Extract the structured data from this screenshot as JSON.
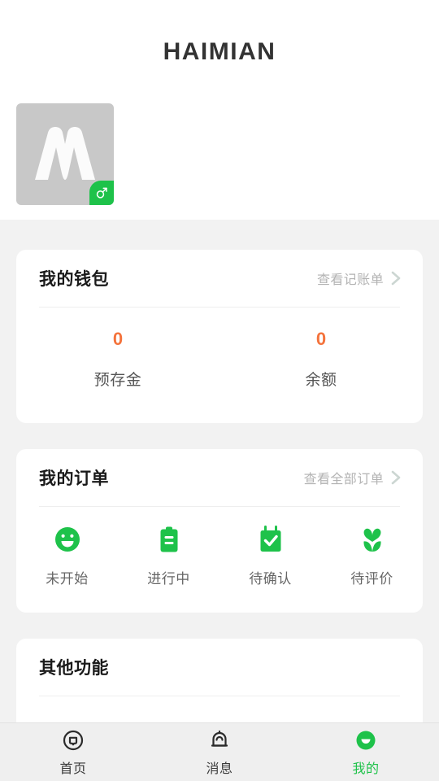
{
  "app": {
    "title": "HAIMIAN",
    "accent_green": "#1ec24a",
    "accent_orange": "#f4733c",
    "page_background": "#f2f2f2",
    "card_background": "#ffffff"
  },
  "profile": {
    "avatar_icon": "letter-m-logo",
    "avatar_background": "#c8c8c8",
    "gender_badge_icon": "male-symbol-icon",
    "gender_badge_color": "#1ec24a"
  },
  "wallet": {
    "title": "我的钱包",
    "action_label": "查看记账单",
    "action_icon": "chevron-right-icon",
    "stats": [
      {
        "value": "0",
        "label": "预存金"
      },
      {
        "value": "0",
        "label": "余额"
      }
    ]
  },
  "orders": {
    "title": "我的订单",
    "action_label": "查看全部订单",
    "action_icon": "chevron-right-icon",
    "items": [
      {
        "label": "未开始",
        "icon": "smiley-face-icon"
      },
      {
        "label": "进行中",
        "icon": "clipboard-icon"
      },
      {
        "label": "待确认",
        "icon": "calendar-check-icon"
      },
      {
        "label": "待评价",
        "icon": "heart-flower-icon"
      }
    ]
  },
  "other_functions": {
    "title": "其他功能"
  },
  "tabbar": {
    "tabs": [
      {
        "label": "首页",
        "icon": "home-circle-icon",
        "active": false
      },
      {
        "label": "消息",
        "icon": "bell-icon",
        "active": false
      },
      {
        "label": "我的",
        "icon": "profile-smiley-icon",
        "active": true
      }
    ]
  }
}
